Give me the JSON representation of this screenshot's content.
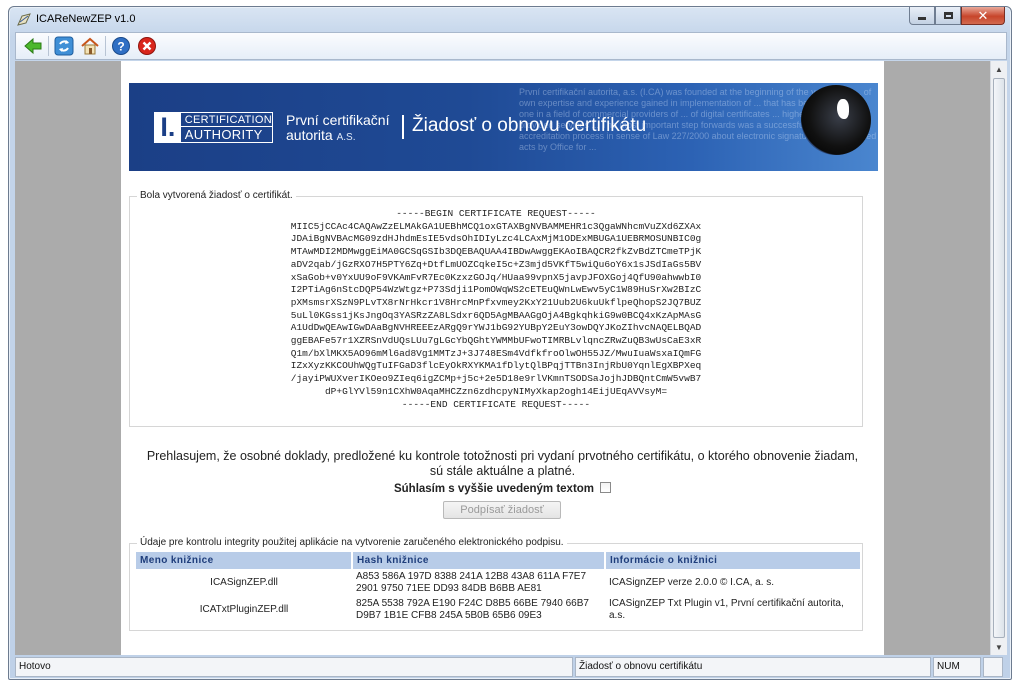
{
  "window": {
    "title": "ICAReNewZEP v1.0"
  },
  "toolbar": {
    "buttons": [
      {
        "name": "back",
        "icon": "arrow-left-icon"
      },
      {
        "name": "refresh",
        "icon": "refresh-icon"
      },
      {
        "name": "home",
        "icon": "home-icon"
      },
      {
        "name": "help",
        "icon": "help-icon"
      },
      {
        "name": "stop",
        "icon": "stop-icon"
      }
    ]
  },
  "banner": {
    "logo_top": "CERTIFICATION",
    "logo_bottom": "AUTHORITY",
    "company_line1": "První certifikační",
    "company_line2": "autorita",
    "company_suffix": "A.S.",
    "heading": "Žiadosť o obnovu certifikátu",
    "background_text": "První certifikační autorita, a.s. (I.CA) was founded at the beginning of the year 2001 ... of own expertise and experience gained in implementation of ... that has become the first one in a field of commercial providers of ... of digital certificates ... highest quality of provided services ... The most important step forwards was a successful completion of accreditation process in sense of Law 227/2000 about electronic signature and connected acts by Office for ..."
  },
  "request_box": {
    "legend": "Bola vytvorená žiadosť o certifikát.",
    "csr_text": "-----BEGIN CERTIFICATE REQUEST-----\nMIIC5jCCAc4CAQAwZzELMAkGA1UEBhMCQ1oxGTAXBgNVBAMMEHR1c3QgaWNhcmVuZXd6ZXAx\nJDAiBgNVBAcMG09zdHJhdmEsIE5vdsOhIDIyLzc4LCAxMjM1ODExMBUGA1UEBRMOSUNBIC0g\nMTAwMDI2MDMwggEiMA0GCSqGSIb3DQEBAQUAA4IBDwAwggEKAoIBAQCR2fkZvBdZTCmeTPjK\naDV2qab/jGzRXO7H5PTY6Zq+DtfLmUOZCqkeI5c+Z3mjd5VKfT5wiQu6oY6x1sJSdIaGs5BV\nxSaGob+v0YxUU9oF9VKAmFvR7Ec0KzxzGOJq/HUaa99vpnX5javpJFOXGoj4QfU90ahwwbI0\nI2PTiAg6nStcDQP54WzWtgz+P73Sdji1PomOWqWS2cETEuQWnLwEwv5yC1W89HuSrXw2BIzC\npXMsmsrXSzN9PLvTX8rNrHkcr1V8HrcMnPfxvmey2KxY21Uub2U6kuUkflpeQhopS2JQ7BUZ\n5uLl0KGss1jKsJngOq3YASRzZA8LSdxr6QD5AgMBAAGgOjA4BgkqhkiG9w0BCQ4xKzApMAsG\nA1UdDwQEAwIGwDAaBgNVHREEEzARgQ9rYWJ1bG92YUBpY2EuY3owDQYJKoZIhvcNAQELBQAD\nggEBAFe57r1XZRSnVdUQsLUu7gLGcYbQGhtYWMMbUFwoTIMRBLvlqncZRwZuQB3wUsCaE3xR\nQ1m/bXlMKX5AO96mMl6ad8Vg1MMTzJ+3J748ESm4VdfkfroOlwOH55JZ/MwuIuaWsxaIQmFG\nIZxXyzKKCOUhWQgTuIFGaD3flcEyOkRXYKMA1fDlytQlBPqjTTBn3InjRbU0YqnlEgXBPXeq\n/jayiPWUXverIKOeo9ZIeq6igZCMp+j5c+2e5D18e9rlVKmnTSODSaJojhJDBQntCmW5vwB7\ndP+GlYVl59n1CXhW0AqaMHCZzn6zdhcpyNIMyXkap2ogh14EijUEqAVVsyM=\n-----END CERTIFICATE REQUEST-----"
  },
  "declaration": {
    "text": "Prehlasujem, že osobné doklady, predložené ku kontrole totožnosti pri vydaní prvotného certifikátu, o ktorého obnovenie žiadam, sú stále aktuálne a platné.",
    "agree_label": "Súhlasím s vyššie uvedeným textom",
    "agree_checked": false,
    "sign_button": "Podpísať žiadosť"
  },
  "integrity": {
    "legend": "Údaje pre kontrolu integrity použitej aplikácie na vytvorenie zaručeného elektronického podpisu.",
    "headers": [
      "Meno knižnice",
      "Hash knižnice",
      "Informácie o knižnici"
    ],
    "rows": [
      {
        "name": "ICASignZEP.dll",
        "hash": "A853 586A 197D 8388 241A 12B8 43A8 611A F7E7 2901 9750 71EE DD93 84DB B6BB AE81",
        "info": "ICASignZEP verze 2.0.0 © I.CA, a. s."
      },
      {
        "name": "ICATxtPluginZEP.dll",
        "hash": "825A 5538 792A E190 F24C D8B5 66BE 7940 66B7 D9B7 1B1E CFB8 245A 5B0B 65B6 09E3",
        "info": "ICASignZEP Txt Plugin v1, První certifikační autorita, a.s."
      }
    ]
  },
  "statusbar": {
    "left": "Hotovo",
    "middle": "Žiadosť o obnovu certifikátu",
    "right": "NUM"
  }
}
